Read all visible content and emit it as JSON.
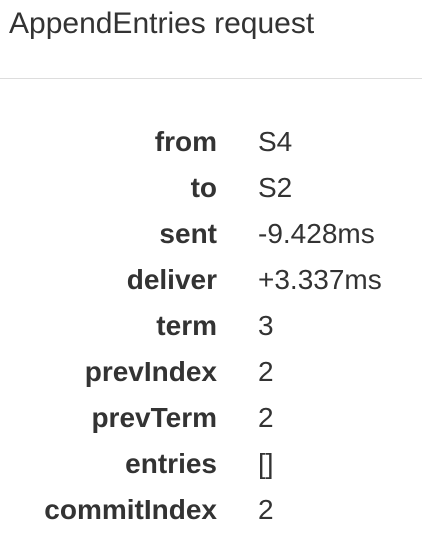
{
  "title": "AppendEntries request",
  "fields": [
    {
      "key": "from",
      "value": "S4"
    },
    {
      "key": "to",
      "value": "S2"
    },
    {
      "key": "sent",
      "value": "-9.428ms"
    },
    {
      "key": "deliver",
      "value": "+3.337ms"
    },
    {
      "key": "term",
      "value": "3"
    },
    {
      "key": "prevIndex",
      "value": "2"
    },
    {
      "key": "prevTerm",
      "value": "2"
    },
    {
      "key": "entries",
      "value": "[]"
    },
    {
      "key": "commitIndex",
      "value": "2"
    }
  ]
}
